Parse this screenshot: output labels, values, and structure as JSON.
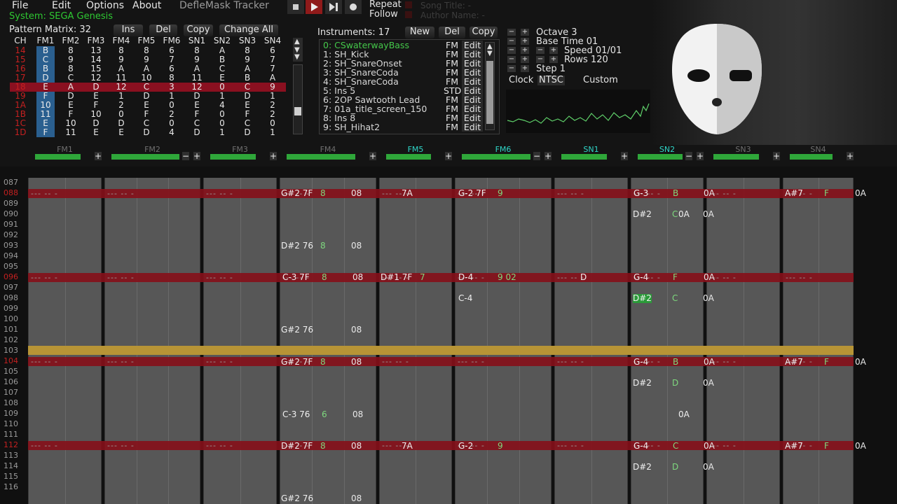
{
  "menu": {
    "file": "File",
    "edit": "Edit",
    "options": "Options",
    "about": "About",
    "app_title": "DefleMask Tracker"
  },
  "transport": {
    "repeat": "Repeat",
    "follow": "Follow",
    "song_title": "Song Title: -",
    "author_name": "Author Name: -"
  },
  "system": "System: SEGA Genesis",
  "pattern_matrix": {
    "label": "Pattern Matrix: 32",
    "ins": "Ins",
    "del": "Del",
    "copy": "Copy",
    "change_all": "Change All",
    "headers": [
      "CH",
      "FM1",
      "FM2",
      "FM3",
      "FM4",
      "FM5",
      "FM6",
      "SN1",
      "SN2",
      "SN3",
      "SN4"
    ],
    "rows": [
      [
        "14",
        "B",
        "8",
        "13",
        "8",
        "8",
        "6",
        "8",
        "A",
        "8",
        "6"
      ],
      [
        "15",
        "C",
        "9",
        "14",
        "9",
        "9",
        "7",
        "9",
        "B",
        "9",
        "7"
      ],
      [
        "16",
        "B",
        "8",
        "15",
        "A",
        "A",
        "6",
        "A",
        "C",
        "A",
        "7"
      ],
      [
        "17",
        "D",
        "C",
        "12",
        "11",
        "10",
        "8",
        "11",
        "E",
        "B",
        "A"
      ],
      [
        "18",
        "E",
        "A",
        "D",
        "12",
        "C",
        "3",
        "12",
        "0",
        "C",
        "9"
      ],
      [
        "19",
        "F",
        "D",
        "E",
        "1",
        "D",
        "1",
        "D",
        "1",
        "D",
        "1"
      ],
      [
        "1A",
        "10",
        "E",
        "F",
        "2",
        "E",
        "0",
        "E",
        "4",
        "E",
        "2"
      ],
      [
        "1B",
        "11",
        "F",
        "10",
        "0",
        "F",
        "2",
        "F",
        "0",
        "F",
        "2"
      ],
      [
        "1C",
        "E",
        "10",
        "D",
        "D",
        "C",
        "0",
        "C",
        "0",
        "C",
        "0"
      ],
      [
        "1D",
        "F",
        "11",
        "E",
        "E",
        "D",
        "4",
        "D",
        "1",
        "D",
        "1"
      ]
    ]
  },
  "instruments": {
    "label": "Instruments: 17",
    "new": "New",
    "del": "Del",
    "copy": "Copy",
    "edit": "Edit",
    "items": [
      {
        "name": "0: CSwaterwayBass",
        "type": "FM"
      },
      {
        "name": "1: SH_Kick",
        "type": "FM"
      },
      {
        "name": "2: SH_SnareOnset",
        "type": "FM"
      },
      {
        "name": "3: SH_SnareCoda",
        "type": "FM"
      },
      {
        "name": "4: SH_SnareCoda",
        "type": "FM"
      },
      {
        "name": "5: Ins 5",
        "type": "STD"
      },
      {
        "name": "6: 2OP Sawtooth Lead",
        "type": "FM"
      },
      {
        "name": "7: 01a_title_screen_150",
        "type": "FM"
      },
      {
        "name": "8: Ins 8",
        "type": "FM"
      },
      {
        "name": "9: SH_Hihat2",
        "type": "FM"
      }
    ]
  },
  "settings": {
    "octave": "Octave 3",
    "base_time": "Base Time 01",
    "speed": "Speed 01/01",
    "rows": "Rows 120",
    "step": "Step 1",
    "clock": "Clock",
    "ntsc": "NTSC",
    "custom": "Custom"
  },
  "channels": [
    "FM1",
    "FM2",
    "FM3",
    "FM4",
    "FM5",
    "FM6",
    "SN1",
    "SN2",
    "SN3",
    "SN4"
  ],
  "row_numbers": [
    "087",
    "088",
    "089",
    "090",
    "091",
    "092",
    "093",
    "094",
    "095",
    "096",
    "097",
    "098",
    "099",
    "100",
    "101",
    "102",
    "103",
    "104",
    "105",
    "106",
    "107",
    "108",
    "109",
    "110",
    "111",
    "112",
    "113",
    "114",
    "115",
    "116"
  ],
  "notes": [
    {
      "t": "G#2 7F",
      "c": "8",
      "e": "08"
    },
    {
      "t": "7A"
    },
    {
      "t": "G-2 7F",
      "c": "9"
    },
    {
      "t": "G-3",
      "c": "B",
      "e": "0A"
    },
    {
      "t": "A#7",
      "c": "F",
      "e": "0A"
    },
    {
      "t": "D#2",
      "c": "C",
      "e": "0A"
    },
    {
      "t": "D#2 76",
      "c": "8",
      "e": "08"
    },
    {
      "t": "0A"
    },
    {
      "t": "C-3 7F",
      "c": "8",
      "e": "08"
    },
    {
      "t": "D#1 7F",
      "c": "7"
    },
    {
      "t": "D-4",
      "c": "9 02"
    },
    {
      "t": "D"
    },
    {
      "t": "G-4",
      "c": "F",
      "e": "0A"
    },
    {
      "t": "C-4"
    },
    {
      "t": "D#2",
      "c": "C",
      "e": "0A"
    },
    {
      "t": "G#2 76",
      "e": "08"
    },
    {
      "t": "G#2 7F",
      "c": "8",
      "e": "08"
    },
    {
      "t": "G-4",
      "c": "B",
      "e": "0A"
    },
    {
      "t": "A#7",
      "c": "F",
      "e": "0A"
    },
    {
      "t": "D#2",
      "c": "D",
      "e": "0A"
    },
    {
      "t": "C-3 76",
      "c": "6",
      "e": "08"
    },
    {
      "t": "0A"
    },
    {
      "t": "D#2 7F",
      "c": "8",
      "e": "08"
    },
    {
      "t": "7A"
    },
    {
      "t": "G-2",
      "c": "9"
    },
    {
      "t": "G-4",
      "c": "C",
      "e": "0A"
    },
    {
      "t": "A#7",
      "c": "F",
      "e": "0A"
    },
    {
      "t": "D#2",
      "c": "D",
      "e": "0A"
    },
    {
      "t": "G#2 76",
      "e": "08"
    }
  ]
}
